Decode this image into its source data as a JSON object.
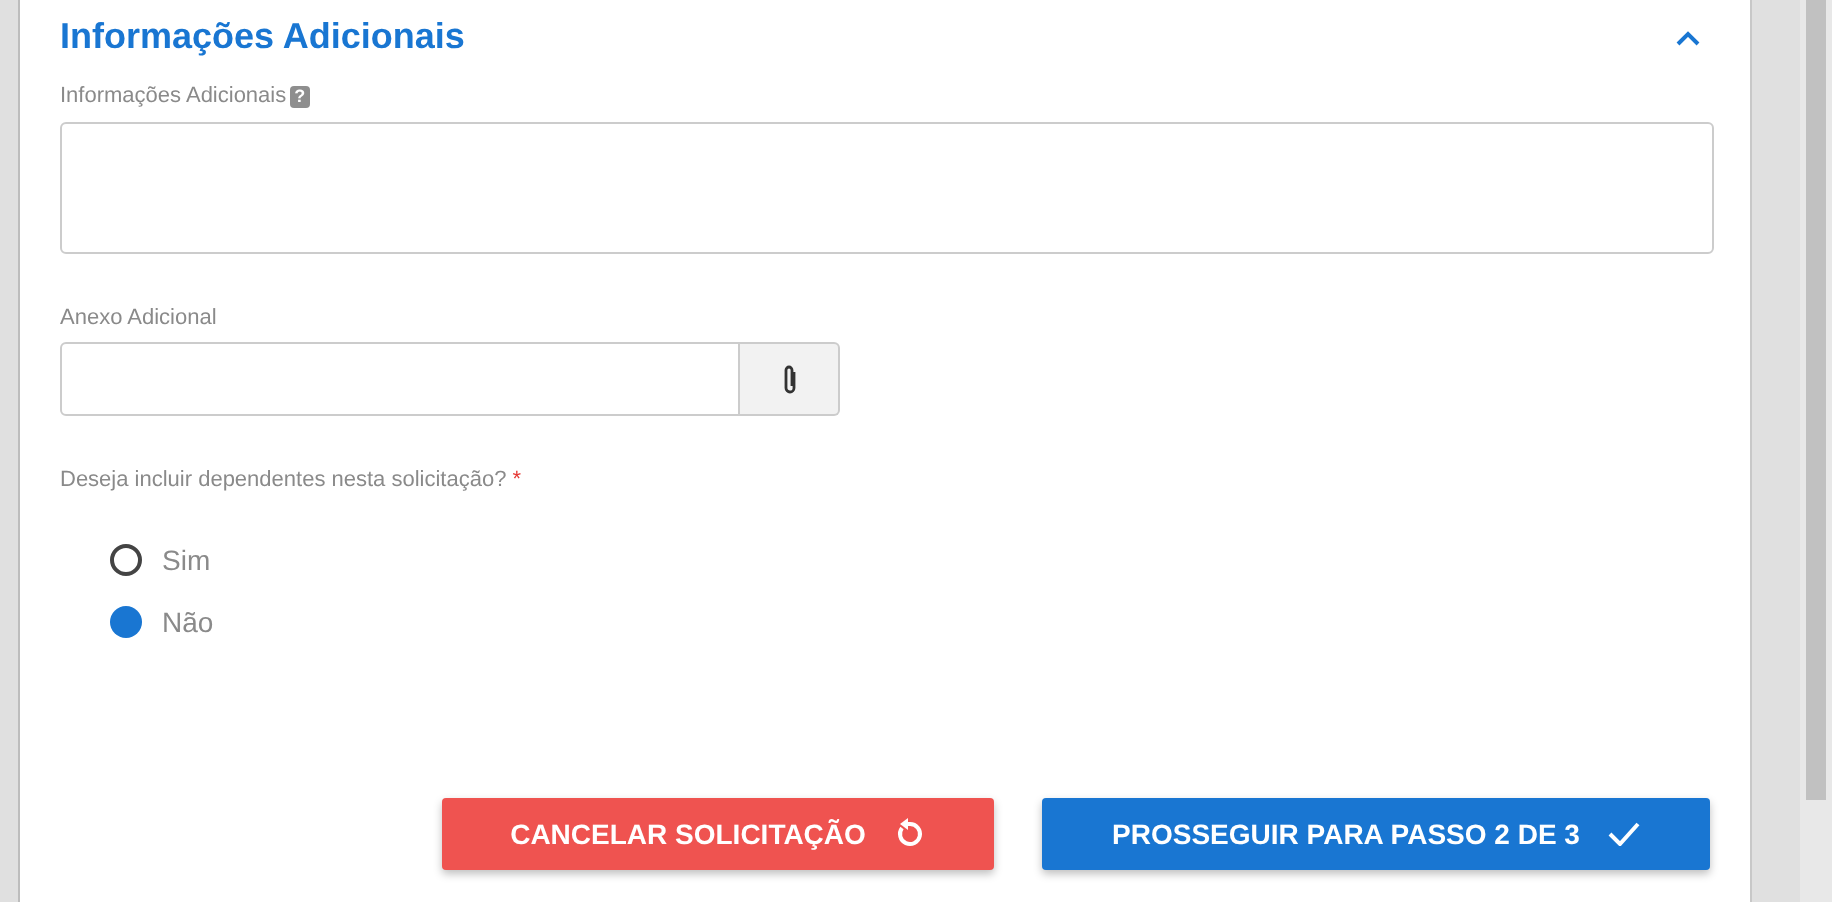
{
  "section": {
    "title": "Informações Adicionais",
    "expanded": true
  },
  "info_field": {
    "label": "Informações Adicionais",
    "help": "?"
  },
  "attachment_field": {
    "label": "Anexo Adicional"
  },
  "dependents_question": {
    "label": "Deseja incluir dependentes nesta solicitação?",
    "required_mark": "*",
    "options": [
      {
        "label": "Sim",
        "selected": false
      },
      {
        "label": "Não",
        "selected": true
      }
    ]
  },
  "buttons": [
    {
      "kind": "cancel",
      "label": "CANCELAR SOLICITAÇÃO"
    },
    {
      "kind": "proceed",
      "label": "PROSSEGUIR PARA PASSO 2 DE 3"
    }
  ]
}
